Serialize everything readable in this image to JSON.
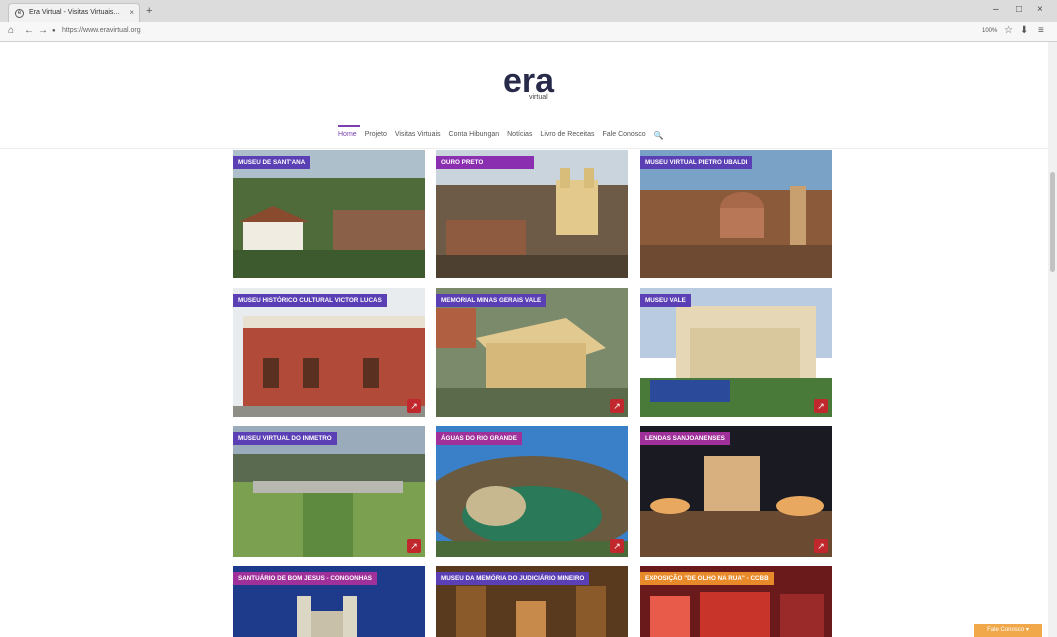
{
  "browser": {
    "tab_title": "Era Virtual - Visitas Virtuais...",
    "tab_close": "×",
    "new_tab": "+",
    "url": "https://www.eravirtual.org",
    "win_min": "–",
    "win_max": "□",
    "win_close": "×",
    "back": "←",
    "forward": "→",
    "home": "⌂",
    "lock": "●",
    "zoom_text": "100%",
    "star": "☆",
    "download": "⬇",
    "menu": "≡"
  },
  "logo": {
    "main": "era",
    "sub": "virtual"
  },
  "nav": {
    "items": [
      "Home",
      "Projeto",
      "Visitas Virtuais",
      "Conta Hibungan",
      "Notícias",
      "Livro de Receitas",
      "Fale Conosco"
    ],
    "search": "🔍"
  },
  "cards": [
    {
      "label": "MUSEU DE SANT'ANA",
      "color": "#5b3fb5",
      "badge": false
    },
    {
      "label": "OURO PRETO",
      "color": "#8a2fb0",
      "badge": false
    },
    {
      "label": "MUSEU VIRTUAL PIETRO UBALDI",
      "color": "#5b3fb5",
      "badge": false
    },
    {
      "label": "MUSEU HISTÓRICO CULTURAL VICTOR LUCAS",
      "color": "#5b3fb5",
      "badge": true
    },
    {
      "label": "MEMORIAL MINAS GERAIS VALE",
      "color": "#5b3fb5",
      "badge": true
    },
    {
      "label": "MUSEU VALE",
      "color": "#5b3fb5",
      "badge": true
    },
    {
      "label": "MUSEU VIRTUAL DO INMETRO",
      "color": "#5b3fb5",
      "badge": true
    },
    {
      "label": "ÁGUAS DO RIO GRANDE",
      "color": "#a0309a",
      "badge": true
    },
    {
      "label": "LENDAS SANJOANENSES",
      "color": "#a0309a",
      "badge": true
    },
    {
      "label": "SANTUÁRIO DE BOM JESUS - CONGONHAS",
      "color": "#a0309a",
      "badge": false
    },
    {
      "label": "MUSEU DA MEMÓRIA DO JUDICIÁRIO MINEIRO",
      "color": "#5b3fb5",
      "badge": false
    },
    {
      "label": "EXPOSIÇÃO \"DE OLHO NA RUA\" - CCBB",
      "color": "#e88a2a",
      "badge": false
    }
  ],
  "badge_icon": "↗",
  "float_button": "Fale Conosco ▾"
}
